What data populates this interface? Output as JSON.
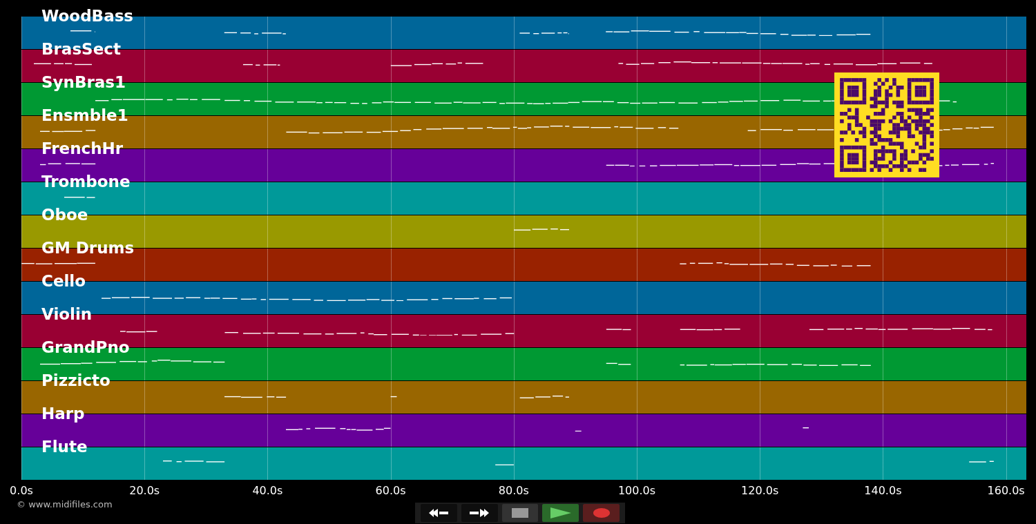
{
  "tracks": [
    {
      "name": "WoodBass",
      "color": "#006699"
    },
    {
      "name": "BrasSect",
      "color": "#990033"
    },
    {
      "name": "SynBras1",
      "color": "#009933"
    },
    {
      "name": "Ensmble1",
      "color": "#996600"
    },
    {
      "name": "FrenchHr",
      "color": "#660099"
    },
    {
      "name": "Trombone",
      "color": "#009999"
    },
    {
      "name": "Oboe",
      "color": "#999900"
    },
    {
      "name": "GM Drums",
      "color": "#992200"
    },
    {
      "name": "Cello",
      "color": "#006699"
    },
    {
      "name": "Violin",
      "color": "#990033"
    },
    {
      "name": "GrandPno",
      "color": "#009933"
    },
    {
      "name": "Pizzicto",
      "color": "#996600"
    },
    {
      "name": "Harp",
      "color": "#660099"
    },
    {
      "name": "Flute",
      "color": "#009999"
    }
  ],
  "time_axis": {
    "ticks": [
      "0.0s",
      "20.0s",
      "40.0s",
      "60.0s",
      "80.0s",
      "100.0s",
      "120.0s",
      "140.0s",
      "160.0s"
    ]
  },
  "copyright": "© www.midifiles.com",
  "transport": [
    {
      "kind": "rewind"
    },
    {
      "kind": "forward"
    },
    {
      "kind": "stop"
    },
    {
      "kind": "play"
    },
    {
      "kind": "record"
    }
  ]
}
